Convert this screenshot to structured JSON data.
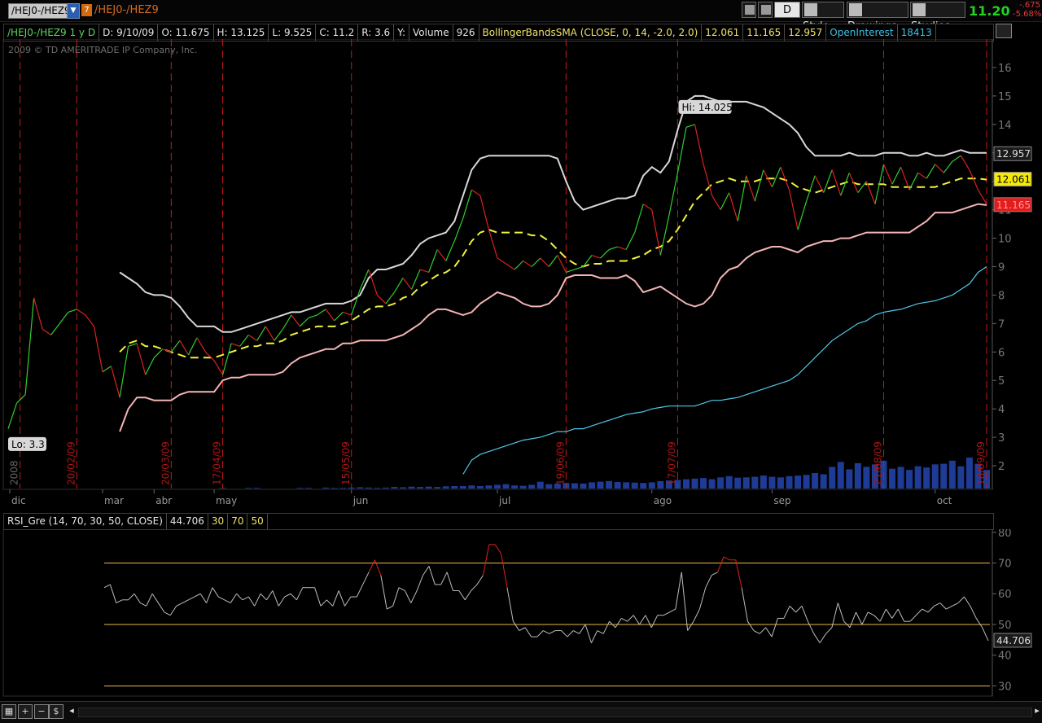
{
  "toolbar": {
    "symbol": "/HEJ0-/HEZ9",
    "badge": "7",
    "title": "/HEJ0-/HEZ9",
    "aggregation": "D",
    "style_label": "Style",
    "drawings_label": "Drawings",
    "studies_label": "Studies",
    "last_price": "11.20",
    "change": "-.675",
    "change_pct": "-5.68%"
  },
  "infobar": {
    "symbol_period": "/HEJ0-/HEZ9 1 y D",
    "date": "D: 9/10/09",
    "open": "O: 11.675",
    "high": "H: 13.125",
    "low": "L: 9.525",
    "close": "C: 11.2",
    "range": "R: 3.6",
    "y": "Y:",
    "volume_label": "Volume",
    "volume_value": "926",
    "bollinger_label": "BollingerBandsSMA (CLOSE, 0, 14, -2.0, 2.0)",
    "bb_mid": "12.061",
    "bb_low": "11.165",
    "bb_up": "12.957",
    "oi_label": "OpenInterest",
    "oi_value": "18413"
  },
  "copyright": "2009 © TD AMERITRADE IP Company, Inc.",
  "rsi_bar": {
    "label": "RSI_Gre (14, 70, 30, 50, CLOSE)",
    "value": "44.706",
    "p30": "30",
    "p70": "70",
    "p50": "50"
  },
  "bottombar": {
    "dollar": "$"
  },
  "chart_data": [
    {
      "type": "line",
      "name": "price",
      "x_month_labels": [
        "dic",
        "mar",
        "abr",
        "may",
        "jun",
        "jul",
        "ago",
        "sep",
        "oct"
      ],
      "ylim": [
        1.2,
        17
      ],
      "y_ticks": [
        2,
        3,
        4,
        5,
        6,
        7,
        8,
        9,
        10,
        11,
        12,
        13,
        14,
        15,
        16
      ],
      "vertical_markers": [
        "2008",
        "20/02/09",
        "20/03/09",
        "17/04/09",
        "15/05/09",
        "19/06/09",
        "17/07/09",
        "21/08/09",
        "18/09/09"
      ],
      "annotations": {
        "high": "Hi: 14.025",
        "low": "Lo: 3.3"
      },
      "price_labels": {
        "upper": "12.957",
        "middle": "12.061",
        "last": "11.165"
      },
      "close": [
        3.3,
        4.2,
        4.5,
        7.9,
        6.8,
        6.6,
        7.0,
        7.4,
        7.5,
        7.3,
        6.9,
        5.3,
        5.5,
        4.4,
        6.2,
        6.3,
        5.2,
        5.8,
        6.1,
        6.0,
        6.4,
        5.9,
        6.5,
        6.0,
        5.7,
        5.2,
        6.3,
        6.2,
        6.6,
        6.4,
        6.9,
        6.4,
        6.8,
        7.3,
        6.9,
        7.2,
        7.3,
        7.5,
        7.1,
        7.4,
        7.3,
        8.2,
        8.9,
        8.0,
        7.7,
        8.1,
        8.6,
        8.2,
        8.9,
        8.8,
        9.6,
        9.2,
        9.9,
        10.7,
        11.7,
        11.5,
        10.3,
        9.3,
        9.1,
        8.9,
        9.2,
        9.0,
        9.3,
        9.0,
        9.4,
        8.8,
        8.9,
        9.0,
        9.4,
        9.3,
        9.6,
        9.7,
        9.6,
        10.2,
        11.2,
        11.0,
        9.4,
        10.8,
        12.3,
        13.9,
        14.0,
        12.6,
        11.5,
        11.0,
        11.6,
        10.6,
        12.2,
        11.3,
        12.4,
        11.8,
        12.5,
        11.7,
        10.3,
        11.3,
        12.2,
        11.6,
        12.4,
        11.5,
        12.3,
        11.6,
        12.0,
        11.2,
        12.6,
        11.9,
        12.5,
        11.7,
        12.3,
        12.1,
        12.6,
        12.3,
        12.7,
        12.9,
        12.4,
        11.7,
        11.2
      ],
      "bb_upper": [
        null,
        null,
        null,
        null,
        null,
        null,
        null,
        null,
        null,
        null,
        null,
        null,
        null,
        8.8,
        8.6,
        8.4,
        8.1,
        8.0,
        8.0,
        7.9,
        7.6,
        7.2,
        6.9,
        6.9,
        6.9,
        6.7,
        6.7,
        6.8,
        6.9,
        7.0,
        7.1,
        7.2,
        7.3,
        7.4,
        7.4,
        7.5,
        7.6,
        7.7,
        7.7,
        7.7,
        7.8,
        8.0,
        8.6,
        8.9,
        8.9,
        9.0,
        9.1,
        9.4,
        9.8,
        10.0,
        10.1,
        10.2,
        10.6,
        11.5,
        12.4,
        12.8,
        12.9,
        12.9,
        12.9,
        12.9,
        12.9,
        12.9,
        12.9,
        12.9,
        12.8,
        12.0,
        11.3,
        11.0,
        11.1,
        11.2,
        11.3,
        11.4,
        11.4,
        11.5,
        12.2,
        12.5,
        12.3,
        12.7,
        13.8,
        14.8,
        15.0,
        15.0,
        14.9,
        14.8,
        14.8,
        14.8,
        14.8,
        14.7,
        14.6,
        14.4,
        14.2,
        14.0,
        13.7,
        13.2,
        12.9,
        12.9,
        12.9,
        12.9,
        13.0,
        12.9,
        12.9,
        12.9,
        13.0,
        13.0,
        13.0,
        12.9,
        12.9,
        13.0,
        12.9,
        12.9,
        13.0,
        13.1,
        13.0,
        13.0,
        13.0
      ],
      "bb_middle": [
        null,
        null,
        null,
        null,
        null,
        null,
        null,
        null,
        null,
        null,
        null,
        null,
        null,
        6.0,
        6.3,
        6.4,
        6.2,
        6.2,
        6.1,
        6.0,
        5.9,
        5.8,
        5.8,
        5.8,
        5.8,
        5.9,
        6.0,
        6.1,
        6.2,
        6.2,
        6.3,
        6.3,
        6.4,
        6.6,
        6.7,
        6.8,
        6.9,
        6.9,
        6.9,
        7.0,
        7.1,
        7.3,
        7.5,
        7.6,
        7.6,
        7.7,
        7.9,
        8.0,
        8.3,
        8.5,
        8.7,
        8.8,
        9.0,
        9.4,
        9.9,
        10.2,
        10.3,
        10.2,
        10.2,
        10.2,
        10.2,
        10.1,
        10.1,
        9.9,
        9.6,
        9.3,
        9.1,
        9.0,
        9.1,
        9.1,
        9.2,
        9.2,
        9.2,
        9.3,
        9.4,
        9.6,
        9.7,
        9.9,
        10.3,
        10.8,
        11.3,
        11.6,
        11.9,
        12.0,
        12.1,
        12.0,
        12.0,
        12.0,
        12.1,
        12.1,
        12.1,
        12.0,
        11.8,
        11.7,
        11.6,
        11.7,
        11.8,
        11.9,
        12.0,
        11.9,
        11.9,
        11.9,
        11.9,
        11.8,
        11.8,
        11.8,
        11.8,
        11.8,
        11.8,
        11.9,
        12.0,
        12.1,
        12.1,
        12.1,
        12.061
      ],
      "bb_lower": [
        null,
        null,
        null,
        null,
        null,
        null,
        null,
        null,
        null,
        null,
        null,
        null,
        null,
        3.2,
        4.0,
        4.4,
        4.4,
        4.3,
        4.3,
        4.3,
        4.5,
        4.6,
        4.6,
        4.6,
        4.6,
        5.0,
        5.1,
        5.1,
        5.2,
        5.2,
        5.2,
        5.2,
        5.3,
        5.6,
        5.8,
        5.9,
        6.0,
        6.1,
        6.1,
        6.3,
        6.3,
        6.4,
        6.4,
        6.4,
        6.4,
        6.5,
        6.6,
        6.8,
        7.0,
        7.3,
        7.5,
        7.5,
        7.4,
        7.3,
        7.4,
        7.7,
        7.9,
        8.1,
        8.0,
        7.9,
        7.7,
        7.6,
        7.6,
        7.7,
        8.0,
        8.6,
        8.7,
        8.7,
        8.7,
        8.6,
        8.6,
        8.6,
        8.7,
        8.5,
        8.1,
        8.2,
        8.3,
        8.1,
        7.9,
        7.7,
        7.6,
        7.7,
        8.0,
        8.6,
        8.9,
        9.0,
        9.3,
        9.5,
        9.6,
        9.7,
        9.7,
        9.6,
        9.5,
        9.7,
        9.8,
        9.9,
        9.9,
        10.0,
        10.0,
        10.1,
        10.2,
        10.2,
        10.2,
        10.2,
        10.2,
        10.2,
        10.4,
        10.6,
        10.9,
        10.9,
        10.9,
        11.0,
        11.1,
        11.2,
        11.165
      ],
      "open_interest_right_scale": [
        null,
        null,
        null,
        null,
        null,
        null,
        null,
        null,
        null,
        null,
        null,
        null,
        null,
        null,
        null,
        null,
        null,
        null,
        null,
        null,
        null,
        null,
        null,
        null,
        null,
        null,
        null,
        null,
        null,
        null,
        null,
        null,
        null,
        null,
        null,
        null,
        null,
        null,
        null,
        null,
        null,
        null,
        null,
        null,
        null,
        null,
        null,
        null,
        null,
        null,
        null,
        null,
        null,
        1.7,
        2.2,
        2.4,
        2.5,
        2.6,
        2.7,
        2.8,
        2.9,
        2.95,
        3.0,
        3.1,
        3.2,
        3.2,
        3.3,
        3.3,
        3.4,
        3.5,
        3.6,
        3.7,
        3.8,
        3.85,
        3.9,
        4.0,
        4.05,
        4.1,
        4.1,
        4.1,
        4.1,
        4.2,
        4.3,
        4.3,
        4.35,
        4.4,
        4.5,
        4.6,
        4.7,
        4.8,
        4.9,
        5.0,
        5.2,
        5.5,
        5.8,
        6.1,
        6.4,
        6.6,
        6.8,
        7.0,
        7.1,
        7.3,
        7.4,
        7.45,
        7.5,
        7.6,
        7.7,
        7.75,
        7.8,
        7.9,
        8.0,
        8.2,
        8.4,
        8.8,
        9.0
      ],
      "volume_relative": [
        0,
        0,
        0,
        0,
        0,
        0,
        0,
        0,
        0,
        0,
        0,
        0,
        0,
        0,
        0,
        0,
        0,
        0,
        0,
        0,
        0,
        0,
        0,
        0,
        0,
        0.02,
        0,
        0,
        0.02,
        0.02,
        0,
        0,
        0,
        0,
        0.02,
        0.02,
        0,
        0.03,
        0.02,
        0.02,
        0.03,
        0.04,
        0.03,
        0.02,
        0.03,
        0.05,
        0.04,
        0.06,
        0.05,
        0.06,
        0.05,
        0.07,
        0.08,
        0.08,
        0.1,
        0.08,
        0.1,
        0.12,
        0.14,
        0.1,
        0.09,
        0.12,
        0.22,
        0.14,
        0.16,
        0.18,
        0.17,
        0.16,
        0.2,
        0.22,
        0.24,
        0.21,
        0.2,
        0.19,
        0.18,
        0.2,
        0.24,
        0.26,
        0.28,
        0.3,
        0.32,
        0.34,
        0.3,
        0.36,
        0.4,
        0.35,
        0.36,
        0.38,
        0.42,
        0.38,
        0.36,
        0.4,
        0.42,
        0.44,
        0.5,
        0.46,
        0.7,
        0.86,
        0.62,
        0.82,
        0.7,
        0.78,
        0.9,
        0.64,
        0.7,
        0.6,
        0.72,
        0.68,
        0.78,
        0.8,
        0.9,
        0.72,
        1.0,
        0.8,
        0.6
      ]
    },
    {
      "type": "line",
      "name": "rsi",
      "ylim": [
        28,
        81
      ],
      "y_ticks": [
        30,
        40,
        50,
        60,
        70,
        80
      ],
      "levels": [
        70,
        50,
        30
      ],
      "last_value_label": "44.706",
      "values": [
        62,
        63,
        57,
        58,
        58,
        60,
        57,
        56,
        60,
        57,
        54,
        53,
        56,
        57,
        58,
        59,
        60,
        57,
        62,
        59,
        58,
        57,
        60,
        58,
        59,
        56,
        60,
        58,
        61,
        56,
        59,
        60,
        58,
        62,
        62,
        62,
        56,
        58,
        56,
        61,
        56,
        59,
        59,
        63,
        67,
        71,
        66,
        55,
        56,
        62,
        61,
        57,
        61,
        66,
        69,
        63,
        63,
        67,
        61,
        61,
        58,
        61,
        63,
        66,
        76,
        76,
        73,
        62,
        51,
        48,
        49,
        46,
        46,
        48,
        47,
        48,
        48,
        46,
        48,
        47,
        50,
        44,
        48,
        47,
        51,
        49,
        52,
        51,
        53,
        50,
        53,
        49,
        53,
        53,
        54,
        55,
        67,
        48,
        51,
        55,
        62,
        66,
        67,
        72,
        71,
        71,
        62,
        51,
        48,
        47,
        49,
        46,
        52,
        52,
        56,
        54,
        56,
        51,
        47,
        44,
        47,
        49,
        57,
        51,
        49,
        54,
        50,
        54,
        53,
        51,
        55,
        52,
        55,
        51,
        51,
        53,
        55,
        54,
        56,
        57,
        55,
        56,
        57,
        59,
        56,
        52,
        49,
        44.706
      ]
    }
  ]
}
